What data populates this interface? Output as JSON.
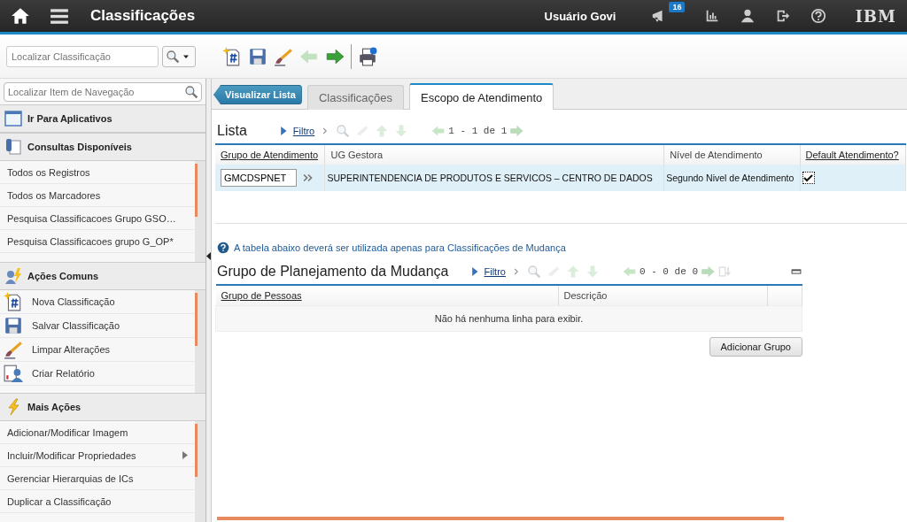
{
  "header": {
    "title": "Classificações",
    "user": "Usuário Govi",
    "notifications": "16",
    "logo": "IBM"
  },
  "toolbar": {
    "search_placeholder": "Localizar Classificação",
    "buttons": [
      {
        "kind": "new",
        "disabled": false
      },
      {
        "kind": "save",
        "disabled": false
      },
      {
        "kind": "brush",
        "disabled": false
      },
      {
        "kind": "back",
        "disabled": true
      },
      {
        "kind": "forward",
        "disabled": false
      },
      {
        "kind": "print",
        "disabled": false
      }
    ]
  },
  "sidebar": {
    "search_placeholder": "Localizar Item de Navegação",
    "sections": [
      {
        "title": "Ir Para Aplicativos"
      },
      {
        "title": "Consultas Disponíveis",
        "items": [
          {
            "label": "Todos os Registros"
          },
          {
            "label": "Todos os Marcadores"
          },
          {
            "label": "Pesquisa Classificacoes Grupo GSO…"
          },
          {
            "label": "Pesquisa Classificacoes grupo G_OP*"
          }
        ]
      },
      {
        "title": "Ações Comuns",
        "items": [
          {
            "label": "Nova Classificação"
          },
          {
            "label": "Salvar Classificação"
          },
          {
            "label": "Limpar Alterações"
          },
          {
            "label": "Criar Relatório"
          }
        ]
      },
      {
        "title": "Mais Ações",
        "items": [
          {
            "label": "Adicionar/Modificar Imagem",
            "submenu": false
          },
          {
            "label": "Incluir/Modificar Propriedades",
            "submenu": true
          },
          {
            "label": "Gerenciar Hierarquias de ICs",
            "submenu": false
          },
          {
            "label": "Duplicar a Classificação",
            "submenu": false
          }
        ]
      }
    ]
  },
  "back_button": "Visualizar Lista",
  "tabs": [
    {
      "label": "Classificações",
      "selected": false
    },
    {
      "label": "Escopo de Atendimento",
      "selected": true
    }
  ],
  "list": {
    "title": "Lista",
    "filter": "Filtro",
    "tools": [
      {
        "kind": "search",
        "disabled": true
      },
      {
        "kind": "eraser",
        "disabled": true
      },
      {
        "kind": "up",
        "disabled": true
      },
      {
        "kind": "down",
        "disabled": true
      }
    ],
    "pagination": "1 - 1 de 1",
    "columns": [
      {
        "label": "Grupo de Atendimento",
        "link": true
      },
      {
        "label": "UG Gestora",
        "link": false
      },
      {
        "label": "Nível de Atendimento",
        "link": false
      },
      {
        "label": "Default Atendimento?",
        "link": true
      }
    ],
    "rows": [
      {
        "group": "GMCDSPNET",
        "ug": "SUPERINTENDENCIA DE PRODUTOS E SERVICOS – CENTRO DE DADOS",
        "level": "Segundo Nivel de Atendimento",
        "default": true,
        "selected": true
      }
    ]
  },
  "note": "A tabela abaixo deverá ser utilizada apenas para Classificações de Mudança",
  "groups": {
    "title": "Grupo de Planejamento da Mudança",
    "filter": "Filtro",
    "tools": [
      {
        "kind": "search",
        "disabled": true
      },
      {
        "kind": "eraser",
        "disabled": true
      },
      {
        "kind": "up",
        "disabled": true
      },
      {
        "kind": "down",
        "disabled": true
      }
    ],
    "pagination": "0 - 0 de 0",
    "columns": [
      {
        "label": "Grupo de Pessoas",
        "link": true
      },
      {
        "label": "Descrição",
        "link": false
      }
    ],
    "empty_message": "Não há nenhuma linha para exibir.",
    "add_button": "Adicionar Grupo"
  }
}
